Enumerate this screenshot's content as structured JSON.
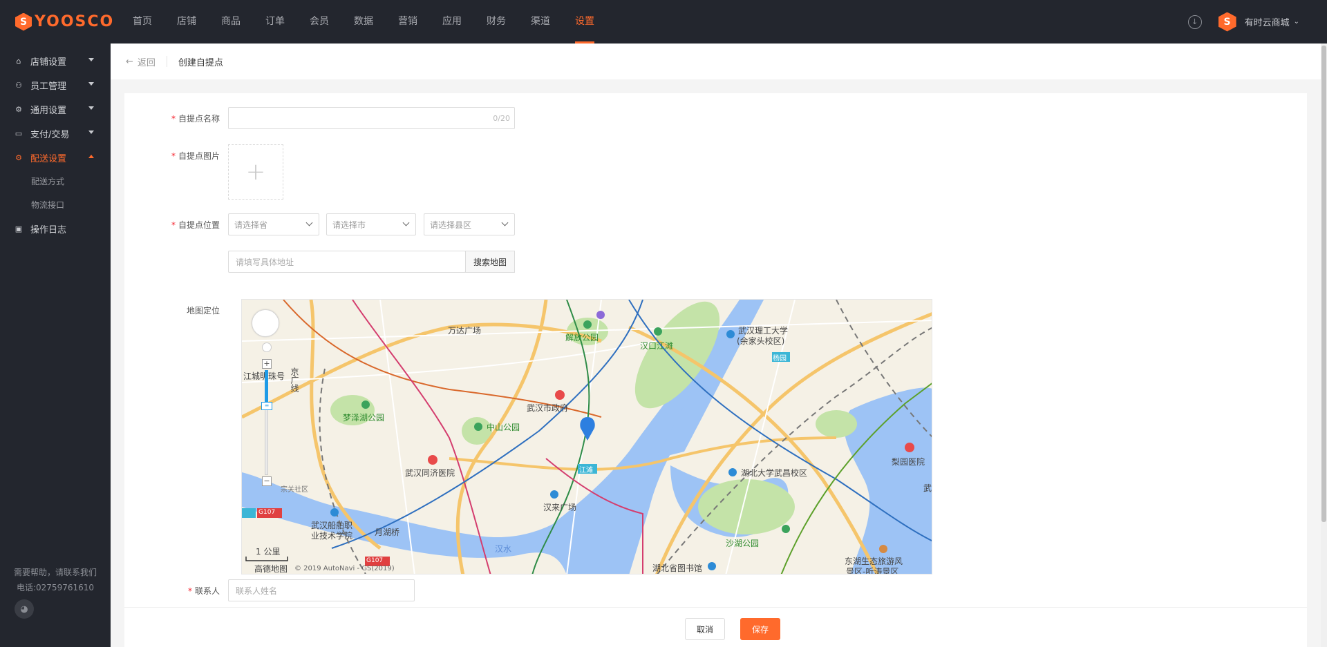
{
  "brand": {
    "logo_letter": "S",
    "logo_text": "YOOSCO",
    "accent_color": "#ff6a2c"
  },
  "topnav": {
    "items": [
      "首页",
      "店铺",
      "商品",
      "订单",
      "会员",
      "数据",
      "营销",
      "应用",
      "财务",
      "渠道",
      "设置"
    ],
    "active": "设置"
  },
  "topright": {
    "download_icon": "download-icon",
    "store_letter": "S",
    "store_name": "有时云商城",
    "caret": "⌄"
  },
  "sidebar": {
    "items": [
      {
        "label": "店铺设置",
        "icon": "store-icon"
      },
      {
        "label": "员工管理",
        "icon": "staff-icon"
      },
      {
        "label": "通用设置",
        "icon": "gear-icon"
      },
      {
        "label": "支付/交易",
        "icon": "card-icon"
      },
      {
        "label": "配送设置",
        "icon": "gear-icon",
        "active": true
      }
    ],
    "sub_items": [
      "配送方式",
      "物流接口"
    ],
    "last_item": {
      "label": "操作日志",
      "icon": "log-icon"
    },
    "help_line1": "需要帮助，请联系我们",
    "help_line2": "电话:02759761610"
  },
  "breadcrumb": {
    "back": "返回",
    "title": "创建自提点"
  },
  "form": {
    "name_label": "自提点名称",
    "name_count": "0/20",
    "image_label": "自提点图片",
    "upload_plus": "+",
    "location_label": "自提点位置",
    "province_placeholder": "请选择省",
    "city_placeholder": "请选择市",
    "district_placeholder": "请选择县区",
    "address_placeholder": "请填写具体地址",
    "search_map_button": "搜索地图",
    "map_label": "地图定位",
    "contact_label": "联系人",
    "contact_placeholder": "联系人姓名",
    "required_mark": "*"
  },
  "map": {
    "labels": [
      "万达广场",
      "解放公园",
      "汉口江滩",
      "武汉理工大学",
      "(余家头校区)",
      "杨园",
      "江城明珠号",
      "京广线",
      "梦泽湖公园",
      "中山公园",
      "武汉市政府",
      "武汉同济医院",
      "江滩",
      "湖北大学武昌校区",
      "梨园医院",
      "汉来广场",
      "武汉船舶职",
      "业技术学院",
      "月湖桥",
      "汉水",
      "沙湖公园",
      "湖北省图书馆",
      "东湖生态旅游风",
      "景区-听涛景区",
      "宗关社区",
      "G107",
      "1 公里",
      "高德地图",
      "© 2019 AutoNavi - GS(2019)",
      "武"
    ],
    "zoom_plus": "+",
    "zoom_minus": "−"
  },
  "footer": {
    "cancel": "取消",
    "save": "保存"
  }
}
